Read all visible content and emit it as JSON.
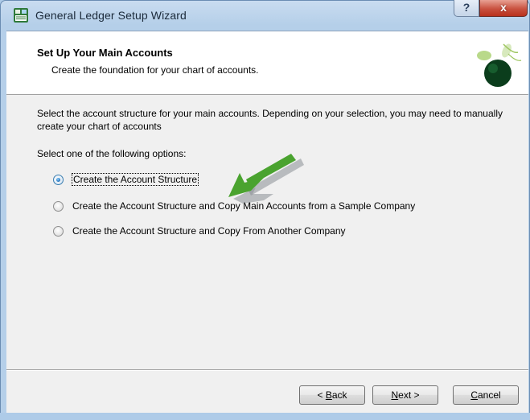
{
  "window": {
    "title": "General Ledger Setup Wizard",
    "help_glyph": "?",
    "close_glyph": "x"
  },
  "header": {
    "title": "Set Up Your Main Accounts",
    "subtitle": "Create the foundation for your chart of accounts."
  },
  "main": {
    "description": "Select the account structure for your main accounts. Depending on your selection, you may need to manually create your chart of accounts",
    "options_prompt": "Select one of the following options:",
    "options": [
      {
        "label": "Create the Account Structure",
        "checked": true
      },
      {
        "label": "Create the Account Structure and Copy Main Accounts from a Sample Company",
        "checked": false
      },
      {
        "label": "Create the Account Structure and Copy From Another Company",
        "checked": false
      }
    ]
  },
  "buttons": {
    "back_prefix": "< ",
    "back_mnemonic": "B",
    "back_rest": "ack",
    "next_mnemonic": "N",
    "next_rest": "ext >",
    "cancel_mnemonic": "C",
    "cancel_rest": "ancel"
  },
  "colors": {
    "accent_arrow": "#4aa32f",
    "title_bar": "#b5cfe9",
    "close_button": "#c9513f"
  },
  "icons": [
    "app-ledger-icon",
    "help-icon",
    "close-icon",
    "sage-leaf-logo",
    "green-arrow-icon"
  ]
}
